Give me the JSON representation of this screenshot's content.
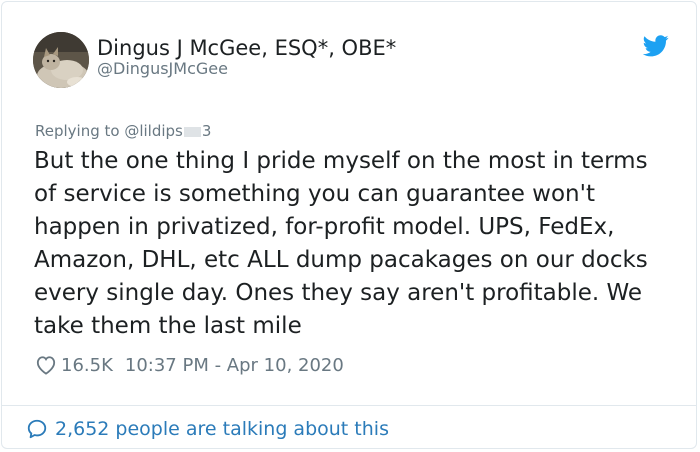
{
  "author": {
    "display_name": "Dingus J McGee, ESQ*, OBE*",
    "handle": "@DingusJMcGee",
    "avatar_icon": "cat-avatar"
  },
  "reply": {
    "prefix": "Replying to ",
    "mention_start": "@lildips",
    "mention_end": "3"
  },
  "tweet": {
    "text": "But the one thing I pride myself on the most in terms of service is something you can guarantee won't happen in privatized, for-profit model. UPS, FedEx, Amazon, DHL, etc ALL dump pacakages on our docks every single day. Ones they say aren't profitable. We take them the last mile"
  },
  "meta": {
    "likes": "16.5K",
    "timestamp": "10:37 PM - Apr 10, 2020"
  },
  "footer": {
    "talking_label": "2,652 people are talking about this"
  },
  "colors": {
    "twitter_blue": "#1da1f2",
    "link_blue": "#2b7bb9",
    "muted_gray": "#697882",
    "text_dark": "#1c2022"
  },
  "icons": [
    "twitter-bird-icon",
    "heart-icon",
    "speech-bubble-icon"
  ]
}
